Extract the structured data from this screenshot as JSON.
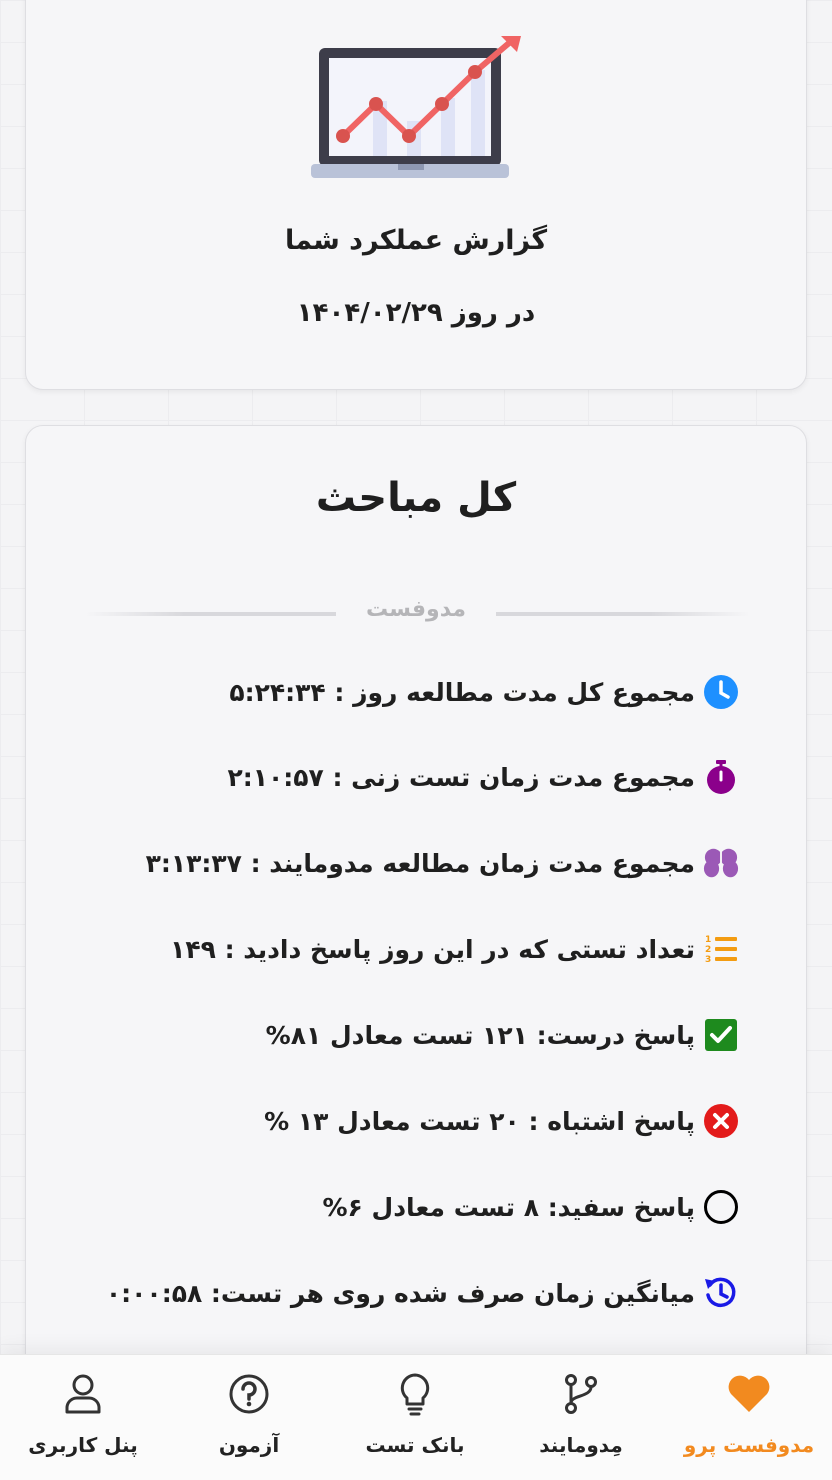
{
  "report": {
    "title": "گزارش عملکرد شما",
    "date_text": "در روز ۱۴۰۴/۰۲/۲۹"
  },
  "section": {
    "title": "کل مباحث",
    "divider_label": "مدوفست"
  },
  "stats": [
    {
      "icon": "clock-icon",
      "text": "مجموع کل مدت مطالعه روز : ۵:۲۴:۳۴",
      "color": "#1e90ff"
    },
    {
      "icon": "stopwatch-icon",
      "text": "مجموع مدت زمان تست زنی : ۲:۱۰:۵۷",
      "color": "#8b008b"
    },
    {
      "icon": "brain-icon",
      "text": "مجموع مدت زمان مطالعه مدومایند : ۳:۱۳:۳۷",
      "color": "#9b59b6"
    },
    {
      "icon": "numbered-list-icon",
      "text": "تعداد تستی که در این روز پاسخ دادید : ۱۴۹",
      "color": "#f39c12"
    },
    {
      "icon": "check-box-icon",
      "text": "پاسخ درست: ۱۲۱ تست معادل ۸۱%",
      "color": "#1e8a1e"
    },
    {
      "icon": "cross-circle-icon",
      "text": "پاسخ اشتباه : ۲۰ تست معادل ۱۳ %",
      "color": "#e31b1b"
    },
    {
      "icon": "empty-circle-icon",
      "text": "پاسخ سفید: ۸ تست معادل ۶%",
      "color": "#000000"
    },
    {
      "icon": "history-icon",
      "text": "میانگین زمان صرف شده روی هر تست: ۰:۰۰:۵۸",
      "color": "#1a1ae6"
    }
  ],
  "nav": {
    "active_color": "#f28a1f",
    "items": [
      {
        "label": "مدوفست پرو",
        "icon": "heart-icon",
        "active": true
      },
      {
        "label": "مِدومایند",
        "icon": "branch-icon",
        "active": false
      },
      {
        "label": "بانک تست",
        "icon": "lightbulb-icon",
        "active": false
      },
      {
        "label": "آزمون",
        "icon": "question-circle-icon",
        "active": false
      },
      {
        "label": "پنل کاربری",
        "icon": "user-icon",
        "active": false
      }
    ]
  }
}
